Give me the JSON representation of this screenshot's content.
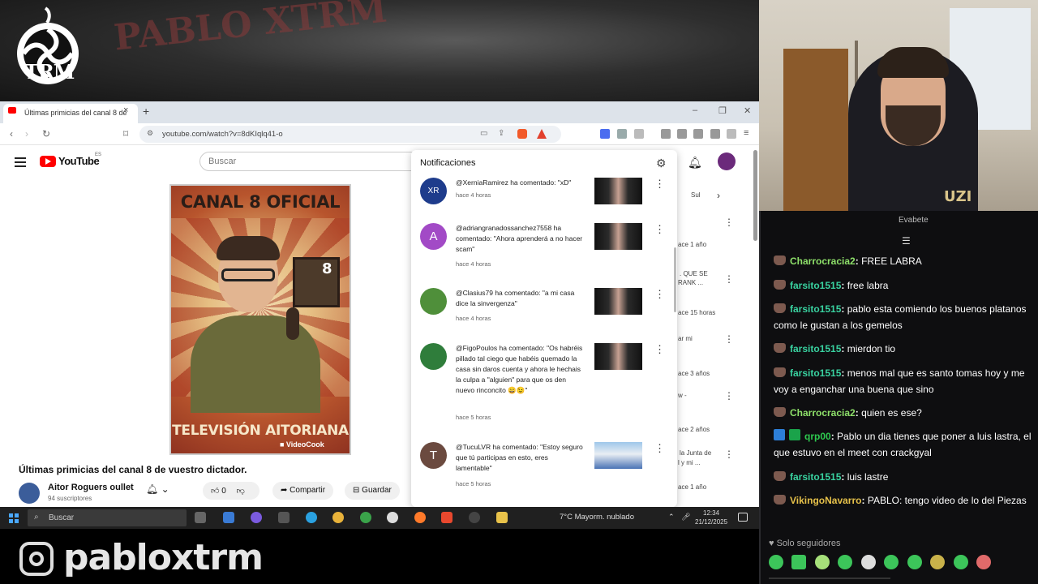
{
  "overlay": {
    "logo_text": "TRM",
    "graffiti_text": "PABLO XTRM",
    "instagram_handle": "pabloxtrm"
  },
  "browser": {
    "tab_title": "Últimas primicias del canal 8 de",
    "tab_close": "×",
    "new_tab": "+",
    "url": "youtube.com/watch?v=8dKIqlq41-o",
    "min": "–",
    "restore": "❐",
    "close": "✕"
  },
  "youtube": {
    "wordmark": "YouTube",
    "region": "ES",
    "search_placeholder": "Buscar",
    "poster_title": "CANAL 8 OFICIAL",
    "poster_tv_number": "8",
    "poster_bottom": "TELEVISIÓN AITORIANA",
    "poster_credit": "■ VideoCook",
    "video_title": "Últimas primicias del canal 8 de vuestro dictador.",
    "channel_name": "Aitor Roguers oullet",
    "channel_subs": "94 suscriptores",
    "like_count": "0",
    "share_label": "Compartir",
    "save_label": "Guardar"
  },
  "notifications": {
    "title": "Notificaciones",
    "items": [
      {
        "text": "@XerniaRamirez ha comentado: \"xD\"",
        "time": "hace 4 horas",
        "avatar_letter": "XR",
        "avatar_color": "#1e3c8c"
      },
      {
        "text": "@adriangranadossanchez7558 ha comentado: \"Ahora aprenderá a no hacer scam\"",
        "time": "hace 4 horas",
        "avatar_letter": "A",
        "avatar_color": "#a24ac6"
      },
      {
        "text": "@Clasius79 ha comentado: \"a mi casa dice la sinvergenza\"",
        "time": "hace 4 horas",
        "avatar_letter": "",
        "avatar_color": "#4f8f3a"
      },
      {
        "text": "@FigoPoulos ha comentado: \"Os habréis pillado tal ciego que habéis quemado la casa sin daros cuenta y ahora le hechais la culpa a \"alguien\" para que os den nuevo rinconcito 😄😉\"",
        "time": "hace 5 horas",
        "avatar_letter": "",
        "avatar_color": "#2f7d3b"
      },
      {
        "text": "@TucuLVR ha comentado: \"Estoy seguro que tú participas en esto, eres lamentable\"",
        "time": "hace 5 horas",
        "avatar_letter": "T",
        "avatar_color": "#6b4a3f"
      }
    ]
  },
  "side_fragments": {
    "sub": "Sul",
    "t1": "ace 1 año",
    "t2": ". QUE SE",
    "t3": "RANK ...",
    "t4": "ace 15 horas",
    "t5": "ar mi",
    "t6": "ace 3 años",
    "t7": "w  -",
    "t8": "ace 2 años",
    "t9": "la Junta de",
    "t10": "l y mi ...",
    "t11": "ace 1 año"
  },
  "taskbar": {
    "search": "Buscar",
    "weather": "7°C  Mayorm. nublado",
    "time": "12:34",
    "date": "21/12/2025"
  },
  "chat": {
    "top_text": "Evabete",
    "messages": [
      {
        "user": "Charrocracia2",
        "user_color": "#8ee06a",
        "text": "FREE LABRA"
      },
      {
        "user": "farsito1515",
        "user_color": "#39d2a0",
        "text": "free labra"
      },
      {
        "user": "farsito1515",
        "user_color": "#39d2a0",
        "text": "pablo esta comiendo los buenos platanos como le gustan a los gemelos"
      },
      {
        "user": "farsito1515",
        "user_color": "#39d2a0",
        "text": "mierdon tio"
      },
      {
        "user": "farsito1515",
        "user_color": "#39d2a0",
        "text": "menos mal que es santo tomas hoy y me voy a enganchar una buena que sino"
      },
      {
        "user": "Charrocracia2",
        "user_color": "#8ee06a",
        "text": "quien es ese?"
      },
      {
        "user": "qrp00",
        "user_color": "#2ec94f",
        "text": "Pablo un dia tienes que poner a luis lastra, el que estuvo en el meet con crackgyal"
      },
      {
        "user": "farsito1515",
        "user_color": "#39d2a0",
        "text": "luis lastre"
      },
      {
        "user": "VikingoNavarro",
        "user_color": "#e6c14a",
        "text": "PABLO: tengo video de lo del Piezas"
      }
    ],
    "followers_only": "♥ Solo seguidores"
  },
  "colors": {
    "youtube_red": "#ff0000",
    "taskbar": "#202020",
    "chat_bg": "#0e0e10"
  }
}
